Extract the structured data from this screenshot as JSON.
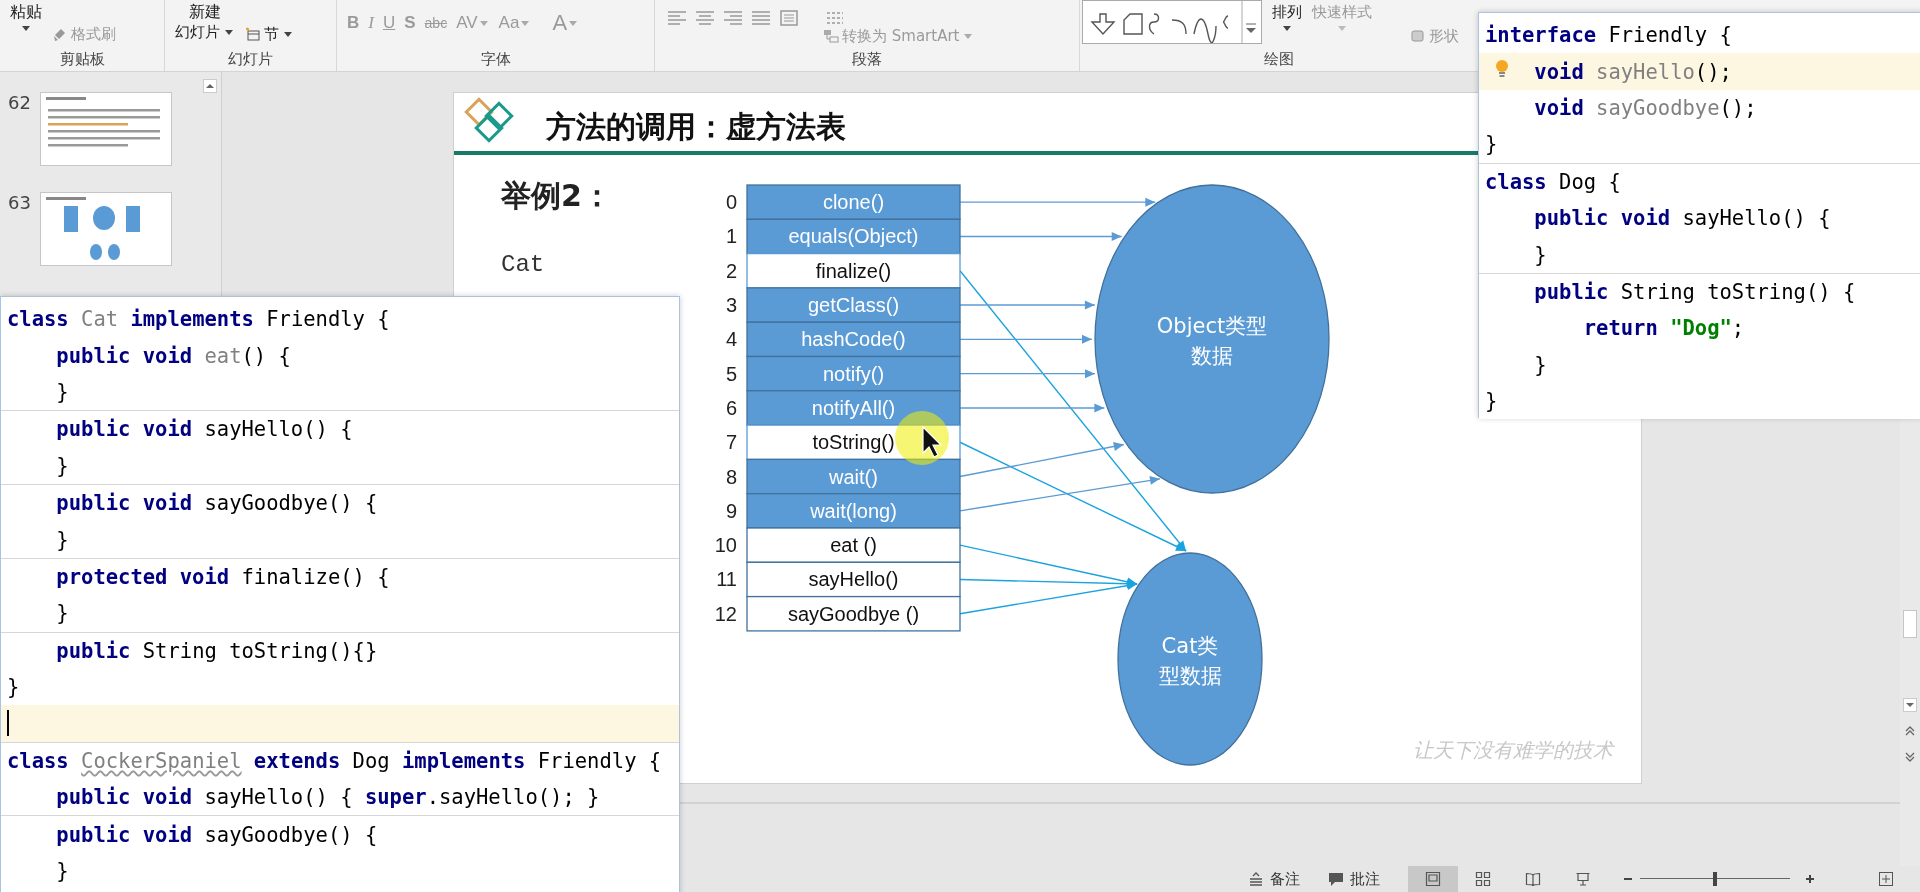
{
  "ribbon": {
    "groups": [
      {
        "kind": "clipboard",
        "label": "剪贴板",
        "items": [
          "粘贴",
          "格式刷"
        ]
      },
      {
        "kind": "slides",
        "label": "幻灯片",
        "items": [
          "新建",
          "幻灯片",
          "节"
        ]
      },
      {
        "kind": "font",
        "label": "字体",
        "items": [
          "B",
          "I",
          "U",
          "S",
          "abc",
          "AV",
          "Aa",
          "A"
        ]
      },
      {
        "kind": "paragraph",
        "label": "段落",
        "items": [
          "转换为 SmartArt"
        ]
      },
      {
        "kind": "drawing",
        "label": "绘图",
        "items": [
          "排列",
          "快速样式",
          "形状"
        ]
      }
    ]
  },
  "thumbnails": [
    {
      "number": "62",
      "kind": "text"
    },
    {
      "number": "63",
      "kind": "diagram"
    }
  ],
  "slide": {
    "title": "方法的调用：虚方法表",
    "subtitle": "举例2：",
    "class_name": "Cat",
    "table": [
      {
        "index": "0",
        "method": "clone()",
        "kind": "object",
        "points_to_cat": false
      },
      {
        "index": "1",
        "method": "equals(Object)",
        "kind": "object",
        "points_to_cat": false
      },
      {
        "index": "2",
        "method": "finalize()",
        "kind": "override",
        "points_to_cat": true
      },
      {
        "index": "3",
        "method": "getClass()",
        "kind": "object",
        "points_to_cat": false
      },
      {
        "index": "4",
        "method": "hashCode()",
        "kind": "object",
        "points_to_cat": false
      },
      {
        "index": "5",
        "method": "notify()",
        "kind": "object",
        "points_to_cat": false
      },
      {
        "index": "6",
        "method": "notifyAll()",
        "kind": "object",
        "points_to_cat": false
      },
      {
        "index": "7",
        "method": "toString()",
        "kind": "override",
        "points_to_cat": true
      },
      {
        "index": "8",
        "method": "wait()",
        "kind": "object",
        "points_to_cat": false
      },
      {
        "index": "9",
        "method": "wait(long)",
        "kind": "object",
        "points_to_cat": false
      },
      {
        "index": "10",
        "method": "eat ()",
        "kind": "own",
        "points_to_cat": true
      },
      {
        "index": "11",
        "method": "sayHello()",
        "kind": "own",
        "points_to_cat": true
      },
      {
        "index": "12",
        "method": "sayGoodbye ()",
        "kind": "own",
        "points_to_cat": true
      }
    ],
    "ellipses": [
      {
        "kind": "object",
        "lines": [
          "Object类型",
          "数据"
        ]
      },
      {
        "kind": "cat",
        "lines": [
          "Cat类",
          "型数据"
        ]
      }
    ],
    "watermark": "让天下没有难学的技术"
  },
  "left_popup": {
    "sections": [
      {
        "lines": [
          {
            "kind": "head",
            "highlighted": false,
            "caret": false,
            "tokens": [
              {
                "text": "class ",
                "kind": "kw"
              },
              {
                "text": "Cat",
                "kind": "gray"
              },
              {
                "text": " implements ",
                "kind": "kw"
              },
              {
                "text": "Friendly {",
                "kind": "p"
              }
            ]
          },
          {
            "kind": "member",
            "highlighted": false,
            "caret": false,
            "tokens": [
              {
                "text": "public void ",
                "kind": "kw"
              },
              {
                "text": "eat",
                "kind": "gray"
              },
              {
                "text": "() {",
                "kind": "p"
              }
            ]
          },
          {
            "kind": "member",
            "highlighted": false,
            "caret": false,
            "tokens": [
              {
                "text": "}",
                "kind": "p"
              }
            ]
          }
        ]
      },
      {
        "lines": [
          {
            "kind": "member",
            "highlighted": false,
            "caret": false,
            "tokens": [
              {
                "text": "public void ",
                "kind": "kw"
              },
              {
                "text": "sayHello() {",
                "kind": "p"
              }
            ]
          },
          {
            "kind": "member",
            "highlighted": false,
            "caret": false,
            "tokens": [
              {
                "text": "}",
                "kind": "p"
              }
            ]
          }
        ]
      },
      {
        "lines": [
          {
            "kind": "member",
            "highlighted": false,
            "caret": false,
            "tokens": [
              {
                "text": "public void ",
                "kind": "kw"
              },
              {
                "text": "sayGoodbye() {",
                "kind": "p"
              }
            ]
          },
          {
            "kind": "member",
            "highlighted": false,
            "caret": false,
            "tokens": [
              {
                "text": "}",
                "kind": "p"
              }
            ]
          }
        ]
      },
      {
        "lines": [
          {
            "kind": "member",
            "highlighted": false,
            "caret": false,
            "tokens": [
              {
                "text": "protected void ",
                "kind": "kw"
              },
              {
                "text": "finalize() {",
                "kind": "p"
              }
            ]
          },
          {
            "kind": "member",
            "highlighted": false,
            "caret": false,
            "tokens": [
              {
                "text": "}",
                "kind": "p"
              }
            ]
          }
        ]
      },
      {
        "lines": [
          {
            "kind": "member",
            "highlighted": false,
            "caret": false,
            "tokens": [
              {
                "text": "public ",
                "kind": "kw"
              },
              {
                "text": "String toString(){}",
                "kind": "p"
              }
            ]
          },
          {
            "kind": "head",
            "highlighted": false,
            "caret": false,
            "tokens": [
              {
                "text": "}",
                "kind": "p"
              }
            ]
          },
          {
            "kind": "head",
            "highlighted": true,
            "caret": true
          }
        ]
      },
      {
        "lines": [
          {
            "kind": "head",
            "highlighted": false,
            "caret": false,
            "tokens": [
              {
                "text": "class ",
                "kind": "kw"
              },
              {
                "text": "CockerSpaniel",
                "kind": "warn"
              },
              {
                "text": " extends ",
                "kind": "kw"
              },
              {
                "text": "Dog ",
                "kind": "p"
              },
              {
                "text": "implements ",
                "kind": "kw"
              },
              {
                "text": "Friendly {",
                "kind": "p"
              }
            ]
          },
          {
            "kind": "member",
            "highlighted": false,
            "caret": false,
            "tokens": [
              {
                "text": "public void ",
                "kind": "kw"
              },
              {
                "text": "sayHello() { ",
                "kind": "p"
              },
              {
                "text": "super",
                "kind": "kw"
              },
              {
                "text": ".sayHello(); }",
                "kind": "p"
              }
            ]
          }
        ]
      },
      {
        "lines": [
          {
            "kind": "member",
            "highlighted": false,
            "caret": false,
            "tokens": [
              {
                "text": "public void ",
                "kind": "kw"
              },
              {
                "text": "sayGoodbye() {",
                "kind": "p"
              }
            ]
          },
          {
            "kind": "member",
            "highlighted": false,
            "caret": false,
            "tokens": [
              {
                "text": "}",
                "kind": "p"
              }
            ]
          }
        ]
      }
    ]
  },
  "right_popup": {
    "sections": [
      {
        "lines": [
          {
            "kind": "head",
            "highlighted": false,
            "hint": false,
            "tokens": [
              {
                "text": "interface ",
                "kind": "kw"
              },
              {
                "text": "Friendly {",
                "kind": "p"
              }
            ]
          },
          {
            "kind": "member",
            "highlighted": true,
            "hint": true,
            "tokens": [
              {
                "text": "void ",
                "kind": "kw"
              },
              {
                "text": "sayHello",
                "kind": "gray"
              },
              {
                "text": "();",
                "kind": "p"
              }
            ]
          },
          {
            "kind": "member",
            "highlighted": false,
            "hint": false,
            "tokens": [
              {
                "text": "void ",
                "kind": "kw"
              },
              {
                "text": "sayGoodbye",
                "kind": "gray"
              },
              {
                "text": "();",
                "kind": "p"
              }
            ]
          },
          {
            "kind": "head",
            "highlighted": false,
            "hint": false,
            "tokens": [
              {
                "text": "}",
                "kind": "p"
              }
            ]
          }
        ]
      },
      {
        "lines": [
          {
            "kind": "head",
            "highlighted": false,
            "hint": false,
            "tokens": [
              {
                "text": "class ",
                "kind": "kw"
              },
              {
                "text": "Dog {",
                "kind": "p"
              }
            ]
          },
          {
            "kind": "member",
            "highlighted": false,
            "hint": false,
            "tokens": [
              {
                "text": "public void ",
                "kind": "kw"
              },
              {
                "text": "sayHello() {",
                "kind": "p"
              }
            ]
          },
          {
            "kind": "member",
            "highlighted": false,
            "hint": false,
            "tokens": [
              {
                "text": "}",
                "kind": "p"
              }
            ]
          }
        ]
      },
      {
        "lines": [
          {
            "kind": "member",
            "highlighted": false,
            "hint": false,
            "tokens": [
              {
                "text": "public ",
                "kind": "kw"
              },
              {
                "text": "String toString() {",
                "kind": "p"
              }
            ]
          },
          {
            "kind": "inner",
            "highlighted": false,
            "hint": false,
            "tokens": [
              {
                "text": "return ",
                "kind": "kw"
              },
              {
                "text": "\"Dog\"",
                "kind": "str"
              },
              {
                "text": ";",
                "kind": "p"
              }
            ]
          },
          {
            "kind": "member",
            "highlighted": false,
            "hint": false,
            "tokens": [
              {
                "text": "}",
                "kind": "p"
              }
            ]
          },
          {
            "kind": "head",
            "highlighted": false,
            "hint": false,
            "tokens": [
              {
                "text": "}",
                "kind": "p"
              }
            ]
          }
        ]
      }
    ]
  },
  "status_bar": {
    "notes": "备注",
    "comments": "批注",
    "views": [
      {
        "kind": "normal",
        "selected": true
      },
      {
        "kind": "sorter",
        "selected": false
      },
      {
        "kind": "reading",
        "selected": false
      },
      {
        "kind": "show",
        "selected": false
      }
    ],
    "zoom": {
      "level": 0.5
    }
  }
}
